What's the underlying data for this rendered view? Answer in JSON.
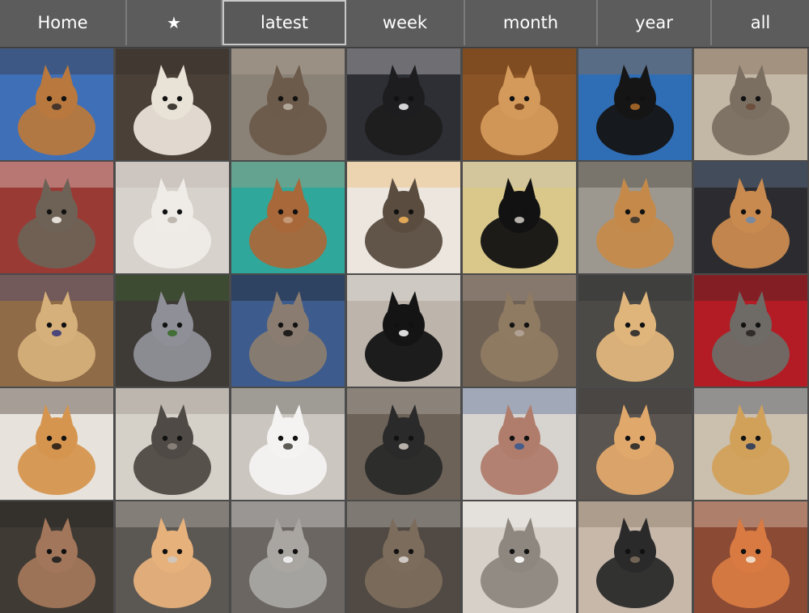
{
  "nav": {
    "tabs": [
      {
        "key": "home",
        "label": "Home"
      },
      {
        "key": "favorites",
        "label": "★",
        "icon": "star-icon"
      },
      {
        "key": "latest",
        "label": "latest",
        "active": true
      },
      {
        "key": "week",
        "label": "week"
      },
      {
        "key": "month",
        "label": "month"
      },
      {
        "key": "year",
        "label": "year"
      },
      {
        "key": "all",
        "label": "all"
      }
    ]
  },
  "colors": {
    "nav_bg": "#5c5c5c",
    "active_border": "#c9c9c9",
    "grid_gap": "#4b4b4b"
  },
  "gallery": {
    "rows": 5,
    "cols": 7,
    "tiles": [
      {
        "bg": "#3f6fb6",
        "cat": "#b8783e",
        "accent": "#3a2e28"
      },
      {
        "bg": "#4a4038",
        "cat": "#e9e2d7",
        "accent": "#2f2a25"
      },
      {
        "bg": "#8a8276",
        "cat": "#6c5a4a",
        "accent": "#b7aea1"
      },
      {
        "bg": "#2e2f35",
        "cat": "#1d1d1f",
        "accent": "#e9e9e9"
      },
      {
        "bg": "#8a5426",
        "cat": "#d49a5b",
        "accent": "#6a3b18"
      },
      {
        "bg": "#2f6db5",
        "cat": "#151515",
        "accent": "#a9692b"
      },
      {
        "bg": "#c3b7a6",
        "cat": "#7b6f62",
        "accent": "#6a4d3a"
      },
      {
        "bg": "#9a3a35",
        "cat": "#6e6256",
        "accent": "#f1ece6"
      },
      {
        "bg": "#d7d2cc",
        "cat": "#efece7",
        "accent": "#b9b2aa"
      },
      {
        "bg": "#2fa79a",
        "cat": "#a8683a",
        "accent": "#c59f7e"
      },
      {
        "bg": "#ece6df",
        "cat": "#5a4d40",
        "accent": "#f0b25a"
      },
      {
        "bg": "#d9c88a",
        "cat": "#121212",
        "accent": "#c9c4bd"
      },
      {
        "bg": "#9c9890",
        "cat": "#c58a4a",
        "accent": "#3a332c"
      },
      {
        "bg": "#2c2c30",
        "cat": "#c98a4f",
        "accent": "#6e8aa8"
      },
      {
        "bg": "#8f6b48",
        "cat": "#d6b07a",
        "accent": "#3a3c7a"
      },
      {
        "bg": "#3e3b36",
        "cat": "#8f8f98",
        "accent": "#3b6b2c"
      },
      {
        "bg": "#3d5c8d",
        "cat": "#8a7c70",
        "accent": "#141414"
      },
      {
        "bg": "#bdb4ab",
        "cat": "#141414",
        "accent": "#f0f0f0"
      },
      {
        "bg": "#6f6255",
        "cat": "#8f7a62",
        "accent": "#b2a497"
      },
      {
        "bg": "#4b4a47",
        "cat": "#e0b57c",
        "accent": "#2a2a2a"
      },
      {
        "bg": "#b31c24",
        "cat": "#6e6b67",
        "accent": "#2a2624"
      },
      {
        "bg": "#e7e2db",
        "cat": "#d6954f",
        "accent": "#2a1d16"
      },
      {
        "bg": "#d6d1c8",
        "cat": "#4f4a45",
        "accent": "#8b857d"
      },
      {
        "bg": "#cbc6c0",
        "cat": "#f4f3f2",
        "accent": "#4e4a44"
      },
      {
        "bg": "#6c6258",
        "cat": "#2a2a2a",
        "accent": "#c6c0b8"
      },
      {
        "bg": "#d7d3ce",
        "cat": "#b07c6b",
        "accent": "#3b5a8f"
      },
      {
        "bg": "#5a5550",
        "cat": "#e1a86c",
        "accent": "#2a2a2a"
      },
      {
        "bg": "#cbbfae",
        "cat": "#d1a15a",
        "accent": "#2b3a5a"
      },
      {
        "bg": "#3f3a34",
        "cat": "#a2765a",
        "accent": "#1f1f1f"
      },
      {
        "bg": "#5b5752",
        "cat": "#e7b17c",
        "accent": "#cfc9c1"
      },
      {
        "bg": "#6b6661",
        "cat": "#a9a6a2",
        "accent": "#f2f2f2"
      },
      {
        "bg": "#514a44",
        "cat": "#7c6c5c",
        "accent": "#d8d2cc"
      },
      {
        "bg": "#d6d0c8",
        "cat": "#8d877f",
        "accent": "#ffffff"
      },
      {
        "bg": "#c7b8aa",
        "cat": "#2a2a2a",
        "accent": "#7a6a5a"
      },
      {
        "bg": "#8a4a34",
        "cat": "#d87a42",
        "accent": "#f1e2d2"
      }
    ]
  }
}
